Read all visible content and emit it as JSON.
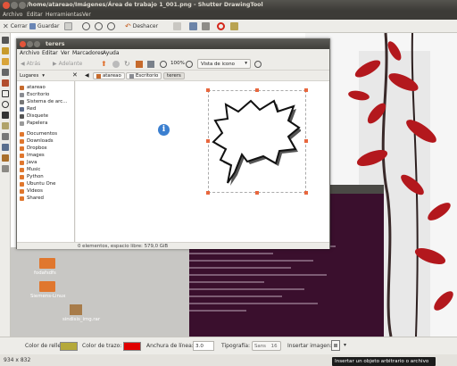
{
  "window": {
    "title": "/home/atareao/Imágenes/Área de trabajo 1_001.png - Shutter DrawingTool"
  },
  "menubar": {
    "items": [
      "Archivo",
      "Editar",
      "Herramientas",
      "Ver"
    ]
  },
  "toolbar": {
    "close_label": "Cerrar",
    "save_label": "Guardar",
    "undo_label": "Deshacer"
  },
  "nautilus": {
    "title": "terers",
    "menu": [
      "Archivo",
      "Editar",
      "Ver",
      "Marcadores",
      "Ayuda"
    ],
    "back_label": "Atrás",
    "forward_label": "Adelante",
    "zoom": "100%",
    "view_mode": "Vista de icono",
    "places_label": "Lugares",
    "breadcrumbs": [
      "atareao",
      "Escritorio",
      "terers"
    ],
    "sidebar": [
      "atareao",
      "Escritorio",
      "Sistema de arc...",
      "Red",
      "Disquete",
      "Papelera",
      "Documentos",
      "Downloads",
      "Dropbox",
      "Images",
      "Java",
      "Music",
      "Python",
      "Ubuntu One",
      "Videos",
      "Shared"
    ],
    "status": "0 elementos, espacio libre: 579,0 GiB"
  },
  "desktop": {
    "icons": [
      "fodafsdfs",
      "Siemens-Linux",
      "sindisis_img.rar"
    ]
  },
  "options_bar": {
    "fill_label": "Color de relleno:",
    "stroke_label": "Color de trazo:",
    "line_width_label": "Anchura de línea:",
    "line_width_value": "3.0",
    "typography_label": "Tipografía:",
    "font_value": "Sans",
    "font_size": "16",
    "insert_image_label": "Insertar imagen:",
    "fill_color": "#b5a93a",
    "stroke_color": "#e00000"
  },
  "statusbar": {
    "dimensions": "934 x 832"
  },
  "tooltip": {
    "text": "Insertar un objeto arbitrario o archivo"
  }
}
